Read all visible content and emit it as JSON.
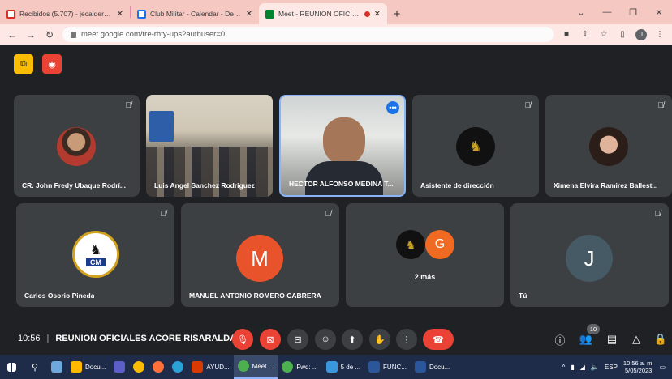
{
  "browser": {
    "tabs": [
      {
        "title": "Recibidos (5.707) - jecalderon@c",
        "fav_color": "#d93025"
      },
      {
        "title": "Club Militar - Calendar - Detalles",
        "fav_color": "#1a73e8"
      },
      {
        "title": "Meet - REUNION OFICIALES",
        "fav_color": "#00832d"
      }
    ],
    "new_tab": "+",
    "url": "meet.google.com/tre-rhty-ups?authuser=0",
    "profile_initial": "J"
  },
  "meet": {
    "tiles": [
      {
        "name": "CR. John Fredy Ubaque Rodrí..."
      },
      {
        "name": "Luis Angel Sanchez Rodriguez"
      },
      {
        "name": "HECTOR ALFONSO MEDINA T..."
      },
      {
        "name": "Asistente de dirección"
      },
      {
        "name": "Ximena Elvira Ramirez Ballest..."
      },
      {
        "name": "Carlos Osorio Pineda"
      },
      {
        "name": "MANUEL ANTONIO ROMERO CABRERA",
        "initial": "M",
        "color": "#e8532c"
      },
      {
        "name": "",
        "more_label": "2 más",
        "initial": "G",
        "color": "#f06b21"
      },
      {
        "name": "Tú",
        "initial": "J",
        "color": "#455a64"
      }
    ],
    "logo_text": "CM",
    "time": "10:56",
    "separator": "|",
    "meeting_title": "REUNION OFICIALES ACORE RISARALDA",
    "participants_count": "10"
  },
  "taskbar": {
    "items": [
      {
        "label": "Docu...",
        "color": "#ffb900"
      },
      {
        "label": "AYUD...",
        "color": "#d83b01"
      },
      {
        "label": "Meet ...",
        "color": "#4caf50"
      },
      {
        "label": "Fwd: ...",
        "color": "#4caf50"
      },
      {
        "label": "5 de ...",
        "color": "#3a96dd"
      },
      {
        "label": "FUNC...",
        "color": "#2b579a"
      },
      {
        "label": "Docu...",
        "color": "#2b579a"
      }
    ],
    "lang": "ESP",
    "time": "10:56 a. m.",
    "date": "5/05/2023"
  }
}
